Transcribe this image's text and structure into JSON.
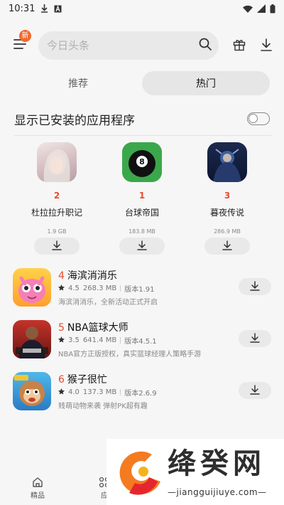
{
  "status_bar": {
    "time": "10:31"
  },
  "search": {
    "placeholder": "今日头条"
  },
  "header": {
    "badge": "新"
  },
  "tabs": [
    {
      "label": "推荐",
      "active": false
    },
    {
      "label": "热门",
      "active": true
    }
  ],
  "toggle": {
    "label": "显示已安装的应用程序",
    "on": false
  },
  "top_apps": [
    {
      "rank": "2",
      "name": "杜拉拉升职记",
      "size": "1.9 GB"
    },
    {
      "rank": "1",
      "name": "台球帝国",
      "size": "183.8 MB"
    },
    {
      "rank": "3",
      "name": "暮夜传说",
      "size": "286.9 MB"
    }
  ],
  "apps": [
    {
      "num": "4",
      "name": "海滨消消乐",
      "rating": "4.5",
      "size": "268.3 MB",
      "version": "版本1.91",
      "desc": "海滨消消乐，全新活动正式开启"
    },
    {
      "num": "5",
      "name": "NBA篮球大师",
      "rating": "3.5",
      "size": "641.4 MB",
      "version": "版本4.5.1",
      "desc": "NBA官方正版授权，真实篮球经理人策略手游"
    },
    {
      "num": "6",
      "name": "猴子很忙",
      "rating": "4.0",
      "size": "137.3 MB",
      "version": "版本2.6.9",
      "desc": "贱萌动物来袭 弹射PK超有趣"
    }
  ],
  "bottom_nav": [
    {
      "label": "精品",
      "icon": "home-icon"
    },
    {
      "label": "应",
      "icon": "apps-icon"
    }
  ],
  "watermark": {
    "title": "绛癸网",
    "url": "—jiangguijiuye.com—"
  },
  "colors": {
    "accent": "#e84b2e",
    "badge": "#f06a2c"
  }
}
